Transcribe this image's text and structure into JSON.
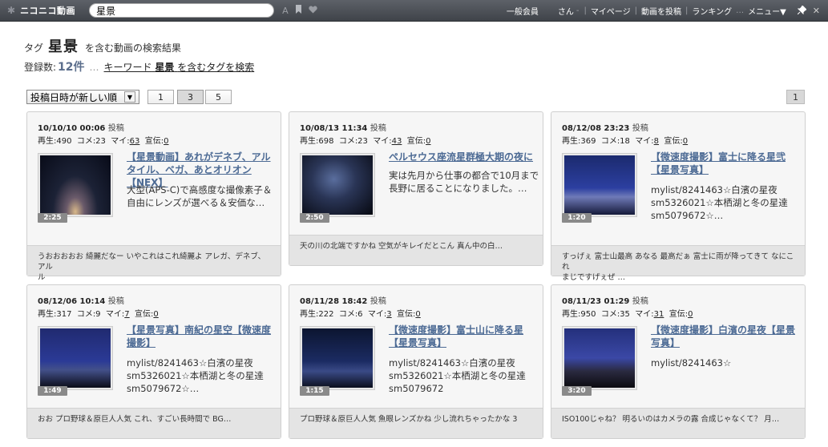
{
  "topbar": {
    "logo": "ニコニコ動画",
    "search_value": "星景",
    "icon_font": "A",
    "member": "一般会員",
    "user": "さん",
    "mypage": "マイページ",
    "upload": "動画を投稿",
    "ranking": "ランキング",
    "menu": "メニュー▼"
  },
  "header": {
    "tag_label": "タグ",
    "tag_name": "星景",
    "suffix": "を含む動画の検索結果",
    "count_label": "登録数:",
    "count": "12件",
    "dots": "…",
    "keyword_prefix": "キーワード",
    "keyword": "星景",
    "keyword_suffix": "を含むタグを検索"
  },
  "toolbar": {
    "sort": "投稿日時が新しい順",
    "pages": [
      "1",
      "3",
      "5"
    ],
    "page_right": "1"
  },
  "labels": {
    "posted": "投稿",
    "play": "再生:",
    "comment": "コメ:",
    "mylist": "マイ:",
    "ad": "宣伝:"
  },
  "cards": [
    {
      "date": "10/10/10 00:06",
      "plays": "490",
      "comments": "23",
      "mylist": "63",
      "ads": "0",
      "duration": "2:25",
      "title": "【星景動画】あれがデネブ、アルタイル、ベガ、あとオリオン【NEX】",
      "desc": "大型(APS-C)で高感度な撮像素子＆自由にレンズが選べる＆安価な…",
      "comment_text": "うおおおおお 綺麗だなー いやこれはこれ綺麗よ アレガ、デネブ、アル",
      "comment_text2": "ル"
    },
    {
      "date": "10/08/13 11:34",
      "plays": "698",
      "comments": "23",
      "mylist": "43",
      "ads": "0",
      "duration": "2:50",
      "title": "ペルセウス座流星群極大期の夜に",
      "desc": "実は先月から仕事の都合で10月まで長野に居ることになりました。…",
      "comment_text": "天の川の北端ですかね 空気がキレイだとこん 真ん中の白…",
      "comment_text2": ""
    },
    {
      "date": "08/12/08 23:23",
      "plays": "369",
      "comments": "18",
      "mylist": "8",
      "ads": "0",
      "duration": "1:20",
      "title": "【微速度撮影】富士に降る星弐【星景写真】",
      "desc": "mylist/8241463☆白濱の星夜 sm5326021☆本栖湖と冬の星達 sm5079672☆…",
      "comment_text": "すっげぇ 富士山最高 あなる 最高だぁ 富士に雨が降ってきて なにこれ",
      "comment_text2": "まじですげぇぜ …"
    },
    {
      "date": "08/12/06 10:14",
      "plays": "317",
      "comments": "9",
      "mylist": "7",
      "ads": "0",
      "duration": "1:49",
      "title": "【星景写真】南紀の星空【微速度撮影】",
      "desc": "mylist/8241463☆白濱の星夜 sm5326021☆本栖湖と冬の星達 sm5079672☆…",
      "comment_text": "おお プロ野球＆原巨人人気 これ、すごい長時間で BG…",
      "comment_text2": ""
    },
    {
      "date": "08/11/28 18:42",
      "plays": "222",
      "comments": "6",
      "mylist": "3",
      "ads": "0",
      "duration": "1:15",
      "title": "【微速度撮影】富士山に降る星【星景写真】",
      "desc": "mylist/8241463☆白濱の星夜 sm5326021☆本栖湖と冬の星達 sm5079672",
      "comment_text": "プロ野球＆原巨人人気 魚眼レンズかね 少し流れちゃったかな 3",
      "comment_text2": ""
    },
    {
      "date": "08/11/23 01:29",
      "plays": "950",
      "comments": "35",
      "mylist": "31",
      "ads": "0",
      "duration": "3:20",
      "title": "【微速度撮影】白濱の星夜【星景写真】",
      "desc": "mylist/8241463☆",
      "comment_text": "ISO100じゃね？ 明るいのはカメラの露 合成じゃなくて？ 月…",
      "comment_text2": ""
    }
  ],
  "colors": {
    "topbar": "#4a4e55",
    "link": "#4c6a94",
    "card_bg": "#f6f6f6",
    "comment_bg": "#e4e4e4"
  }
}
